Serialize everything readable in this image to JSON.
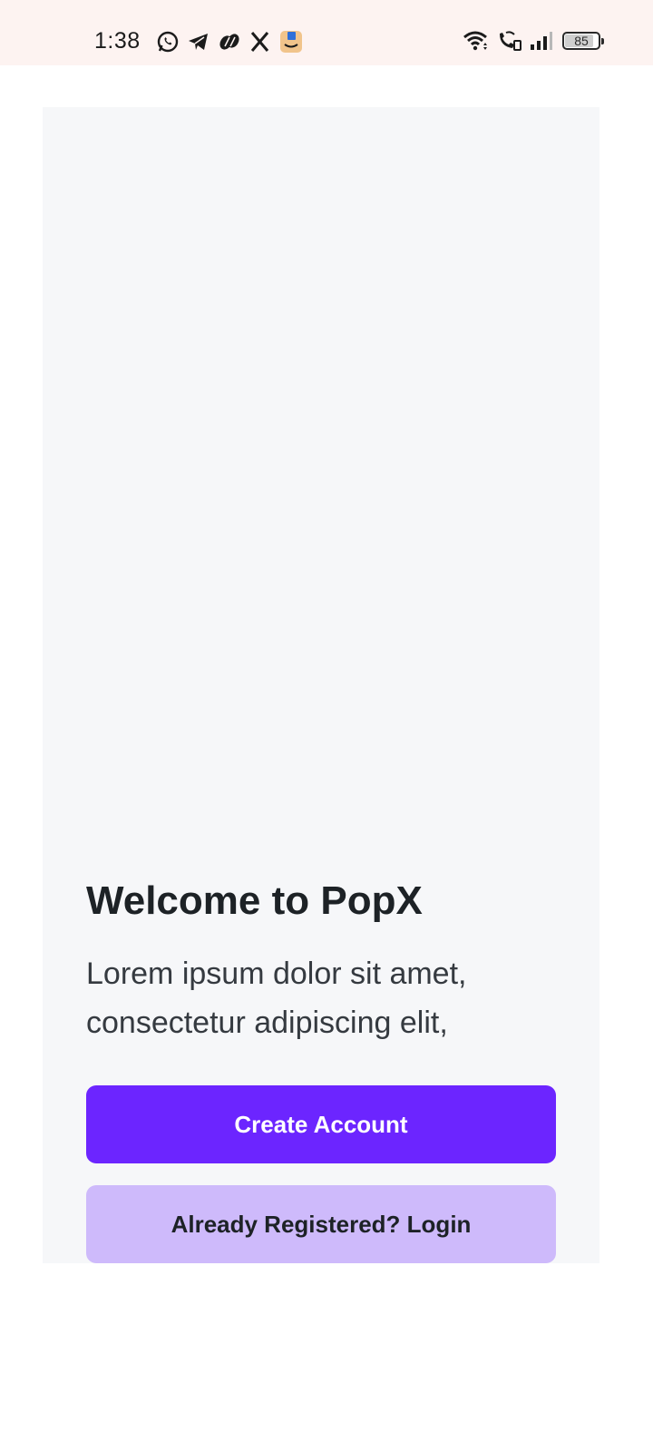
{
  "status_bar": {
    "time": "1:38",
    "notification_icons": [
      "whatsapp-icon",
      "telegram-icon",
      "cloud-app-icon",
      "x-icon",
      "amazon-icon"
    ],
    "system_icons": [
      "wifi-icon",
      "wifi-calling-icon",
      "signal-icon"
    ],
    "battery_level": "85",
    "battery_fraction": 0.85,
    "background_color": "#fdf3f1"
  },
  "welcome": {
    "title": "Welcome to PopX",
    "subtitle": "Lorem ipsum dolor sit amet, consectetur adipiscing elit,",
    "create_account_label": "Create Account",
    "login_label": "Already Registered? Login"
  },
  "colors": {
    "primary": "#6c25ff",
    "secondary": "#cebafb",
    "card_background": "#f6f7f9",
    "title_text": "#1d2226"
  }
}
